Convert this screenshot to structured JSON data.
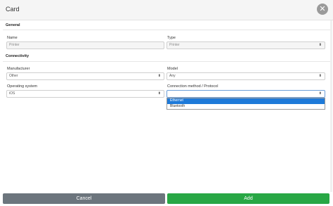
{
  "window": {
    "title": "Card",
    "close_glyph": "✕"
  },
  "sections": {
    "general": "General",
    "connectivity": "Connectivity"
  },
  "fields": {
    "name": {
      "label": "Name",
      "placeholder": "Printer"
    },
    "type": {
      "label": "Type",
      "value": "Printer"
    },
    "manufacturer": {
      "label": "Manufacturer",
      "value": "Other"
    },
    "model": {
      "label": "Model",
      "value": "Any"
    },
    "os": {
      "label": "Operating system",
      "value": "iOS"
    },
    "connection": {
      "label": "Connection method / Protocol",
      "value": "",
      "options": [
        "Ethernet",
        "Bluetooth"
      ],
      "highlighted": "Ethernet"
    }
  },
  "icons": {
    "select_arrow": "⬍",
    "close": "close-icon"
  },
  "buttons": {
    "cancel": "Cancel",
    "add": "Add"
  },
  "colors": {
    "cancel": "#6c757d",
    "add": "#28a745",
    "highlight": "#1e7ad9"
  }
}
